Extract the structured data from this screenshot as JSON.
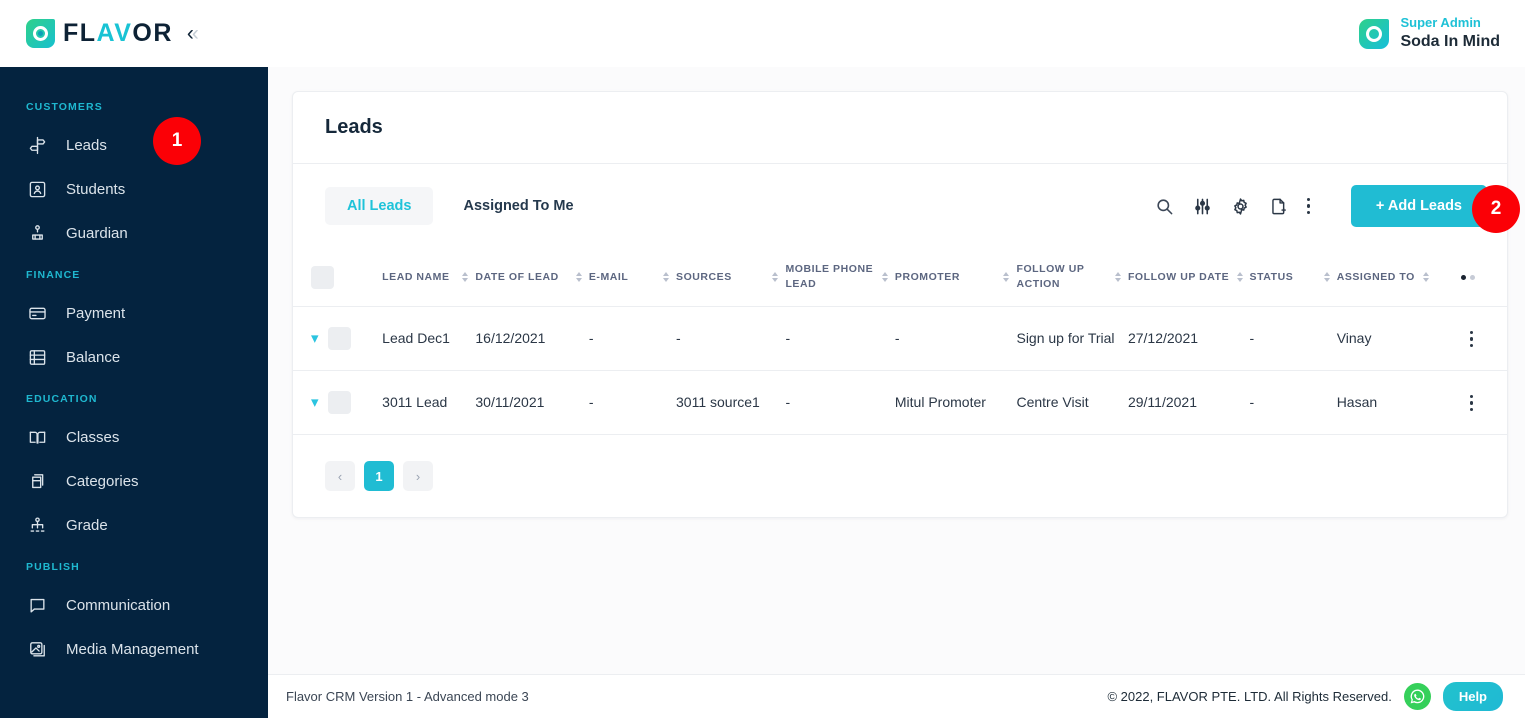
{
  "brand": {
    "logo_text_primary": "FL",
    "logo_text_accent": "AV",
    "logo_text_primary2": "OR",
    "logo_icon": "flavor-logo-icon",
    "collapse_icon": "chevron-double-left-icon",
    "accent_color": "#20bcd3",
    "sidebar_color": "#04233f",
    "badge_color": "#fb0006"
  },
  "topbar": {
    "avatar_icon": "user-avatar-icon",
    "role": "Super Admin",
    "name": "Soda In Mind"
  },
  "sidebar": {
    "sections": [
      {
        "label": "CUSTOMERS",
        "items": [
          {
            "label": "Leads",
            "icon": "signpost-icon"
          },
          {
            "label": "Students",
            "icon": "id-card-person-icon"
          },
          {
            "label": "Guardian",
            "icon": "guardian-hierarchy-icon"
          }
        ]
      },
      {
        "label": "FINANCE",
        "items": [
          {
            "label": "Payment",
            "icon": "credit-card-icon"
          },
          {
            "label": "Balance",
            "icon": "ledger-icon"
          }
        ]
      },
      {
        "label": "EDUCATION",
        "items": [
          {
            "label": "Classes",
            "icon": "open-book-icon"
          },
          {
            "label": "Categories",
            "icon": "stacked-box-icon"
          },
          {
            "label": "Grade",
            "icon": "org-chart-icon"
          }
        ]
      },
      {
        "label": "PUBLISH",
        "items": [
          {
            "label": "Communication",
            "icon": "chat-bubble-icon"
          },
          {
            "label": "Media Management",
            "icon": "image-icon"
          }
        ]
      }
    ]
  },
  "page": {
    "title": "Leads",
    "tabs": [
      {
        "label": "All Leads",
        "active": true
      },
      {
        "label": "Assigned To Me",
        "active": false
      }
    ],
    "tool_icons": [
      {
        "name": "search-icon"
      },
      {
        "name": "filter-sliders-icon"
      },
      {
        "name": "gear-icon"
      },
      {
        "name": "document-add-icon"
      },
      {
        "name": "kebab-menu-icon"
      }
    ],
    "add_button_label": "+ Add Leads"
  },
  "table": {
    "columns": [
      {
        "key": "select",
        "label": ""
      },
      {
        "key": "name",
        "label": "LEAD NAME"
      },
      {
        "key": "date",
        "label": "DATE OF LEAD"
      },
      {
        "key": "email",
        "label": "E-MAIL"
      },
      {
        "key": "sources",
        "label": "SOURCES"
      },
      {
        "key": "mobile",
        "label": "MOBILE PHONE LEAD"
      },
      {
        "key": "promoter",
        "label": "PROMOTER"
      },
      {
        "key": "fu_action",
        "label": "FOLLOW UP ACTION"
      },
      {
        "key": "fu_date",
        "label": "FOLLOW UP DATE"
      },
      {
        "key": "status",
        "label": "STATUS"
      },
      {
        "key": "assigned",
        "label": "ASSIGNED TO"
      },
      {
        "key": "actions",
        "label": ""
      }
    ],
    "rows": [
      {
        "name": "Lead Dec1",
        "date": "16/12/2021",
        "email": "-",
        "sources": "-",
        "mobile": "-",
        "promoter": "-",
        "fu_action": "Sign up for Trial",
        "fu_date": "27/12/2021",
        "status": "-",
        "assigned": "Vinay"
      },
      {
        "name": "3011 Lead",
        "date": "30/11/2021",
        "email": "-",
        "sources": "3011 source1",
        "mobile": "-",
        "promoter": "Mitul Promoter",
        "fu_action": "Centre Visit",
        "fu_date": "29/11/2021",
        "status": "-",
        "assigned": "Hasan"
      }
    ]
  },
  "pagination": {
    "prev_label": "‹",
    "pages": [
      "1"
    ],
    "current": "1",
    "next_label": "›"
  },
  "footer": {
    "version": "Flavor CRM Version 1 - Advanced mode 3",
    "copyright": "© 2022, FLAVOR PTE. LTD. All Rights Reserved.",
    "whatsapp_icon": "whatsapp-icon",
    "help_label": "Help"
  },
  "annotations": [
    {
      "id": "1",
      "label": "1"
    },
    {
      "id": "2",
      "label": "2"
    }
  ]
}
